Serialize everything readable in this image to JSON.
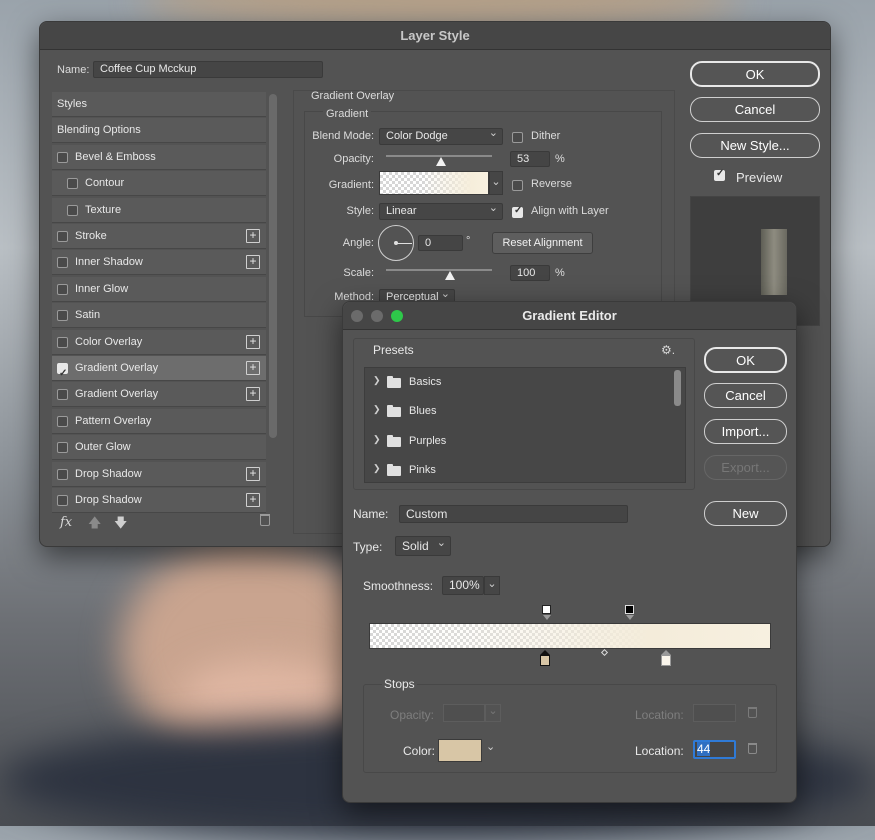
{
  "layer_style": {
    "title": "Layer Style",
    "name_label": "Name:",
    "name_value": "Coffee Cup Mcckup",
    "sidebar": [
      {
        "label": "Styles",
        "checkbox": false,
        "plus": false,
        "checked": false,
        "indent": 0
      },
      {
        "label": "Blending Options",
        "checkbox": false,
        "plus": false,
        "checked": false,
        "indent": 0
      },
      {
        "label": "Bevel & Emboss",
        "checkbox": true,
        "plus": false,
        "checked": false,
        "indent": 0
      },
      {
        "label": "Contour",
        "checkbox": true,
        "plus": false,
        "checked": false,
        "indent": 1
      },
      {
        "label": "Texture",
        "checkbox": true,
        "plus": false,
        "checked": false,
        "indent": 1
      },
      {
        "label": "Stroke",
        "checkbox": true,
        "plus": true,
        "checked": false,
        "indent": 0
      },
      {
        "label": "Inner Shadow",
        "checkbox": true,
        "plus": true,
        "checked": false,
        "indent": 0
      },
      {
        "label": "Inner Glow",
        "checkbox": true,
        "plus": false,
        "checked": false,
        "indent": 0
      },
      {
        "label": "Satin",
        "checkbox": true,
        "plus": false,
        "checked": false,
        "indent": 0
      },
      {
        "label": "Color Overlay",
        "checkbox": true,
        "plus": true,
        "checked": false,
        "indent": 0
      },
      {
        "label": "Gradient Overlay",
        "checkbox": true,
        "plus": true,
        "checked": true,
        "indent": 0
      },
      {
        "label": "Gradient Overlay",
        "checkbox": true,
        "plus": true,
        "checked": false,
        "indent": 0
      },
      {
        "label": "Pattern Overlay",
        "checkbox": true,
        "plus": false,
        "checked": false,
        "indent": 0
      },
      {
        "label": "Outer Glow",
        "checkbox": true,
        "plus": false,
        "checked": false,
        "indent": 0
      },
      {
        "label": "Drop Shadow",
        "checkbox": true,
        "plus": true,
        "checked": false,
        "indent": 0
      },
      {
        "label": "Drop Shadow",
        "checkbox": true,
        "plus": true,
        "checked": false,
        "indent": 0
      }
    ],
    "fx_label": "fx",
    "panel": {
      "section_title": "Gradient Overlay",
      "group_title": "Gradient",
      "blend_mode_label": "Blend Mode:",
      "blend_mode_value": "Color Dodge",
      "dither_label": "Dither",
      "opacity_label": "Opacity:",
      "opacity_value": "53",
      "percent": "%",
      "gradient_label": "Gradient:",
      "reverse_label": "Reverse",
      "style_label": "Style:",
      "style_value": "Linear",
      "align_label": "Align with Layer",
      "angle_label": "Angle:",
      "angle_value": "0",
      "degree": "°",
      "reset_alignment": "Reset Alignment",
      "scale_label": "Scale:",
      "scale_value": "100",
      "method_label": "Method:",
      "method_value": "Perceptual"
    },
    "buttons": {
      "ok": "OK",
      "cancel": "Cancel",
      "new_style": "New Style...",
      "preview": "Preview"
    }
  },
  "gradient_editor": {
    "title": "Gradient Editor",
    "presets_label": "Presets",
    "presets": [
      "Basics",
      "Blues",
      "Purples",
      "Pinks"
    ],
    "buttons": {
      "ok": "OK",
      "cancel": "Cancel",
      "import": "Import...",
      "export": "Export...",
      "new": "New"
    },
    "name_label": "Name:",
    "name_value": "Custom",
    "type_label": "Type:",
    "type_value": "Solid",
    "smoothness_label": "Smoothness:",
    "smoothness_value": "100%",
    "stops_label": "Stops",
    "opacity_label": "Opacity:",
    "location_label": "Location:",
    "color_label": "Color:",
    "location_value": "44",
    "stop_color": "#d8c6a6"
  }
}
